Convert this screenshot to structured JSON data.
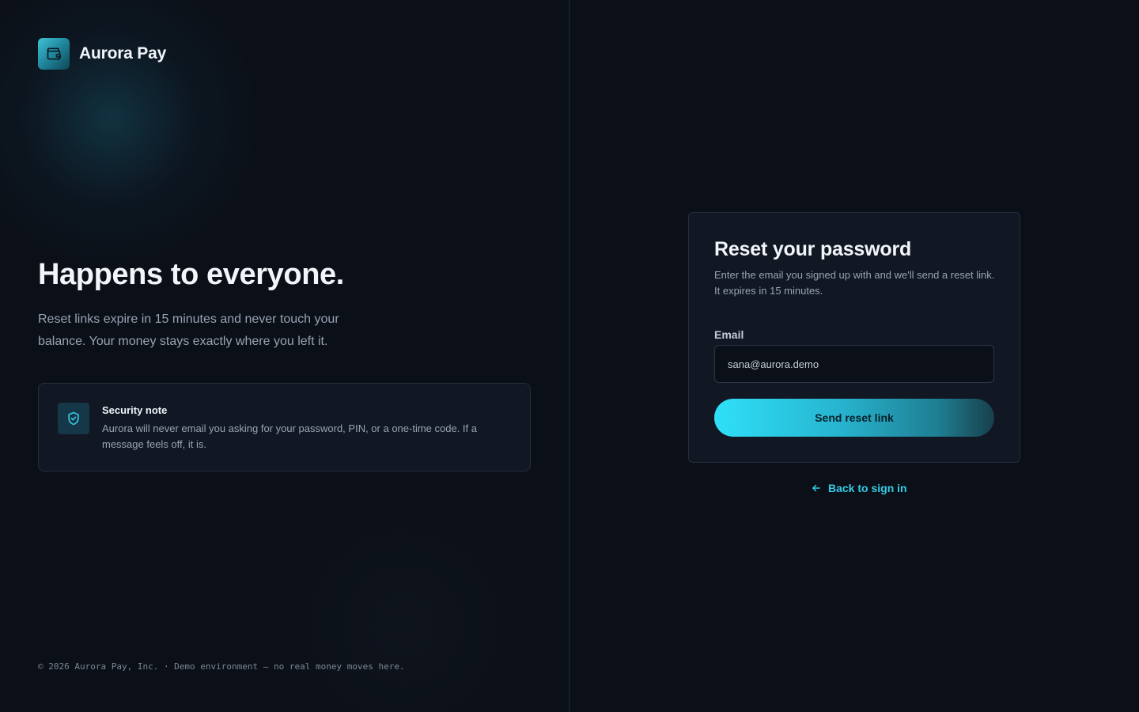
{
  "brand": {
    "name": "Aurora Pay",
    "logo_icon": "wallet-icon",
    "accent": "#33c8e2"
  },
  "hero": {
    "title": "Happens to everyone.",
    "subtitle": "Reset links expire in 15 minutes and never touch your balance. Your money stays exactly where you left it."
  },
  "security_note": {
    "icon": "shield-check-icon",
    "title": "Security note",
    "body": "Aurora will never email you asking for your password, PIN, or a one-time code. If a message feels off, it is."
  },
  "footer": {
    "text": "© 2026 Aurora Pay, Inc. · Demo environment — no real money moves here."
  },
  "reset_form": {
    "title": "Reset your password",
    "subtitle": "Enter the email you signed up with and we'll send a reset link. It expires in 15 minutes.",
    "email_label": "Email",
    "email_value": "sana@aurora.demo",
    "submit_label": "Send reset link"
  },
  "back_link": {
    "label": "Back to sign in",
    "icon": "arrow-left-icon"
  }
}
